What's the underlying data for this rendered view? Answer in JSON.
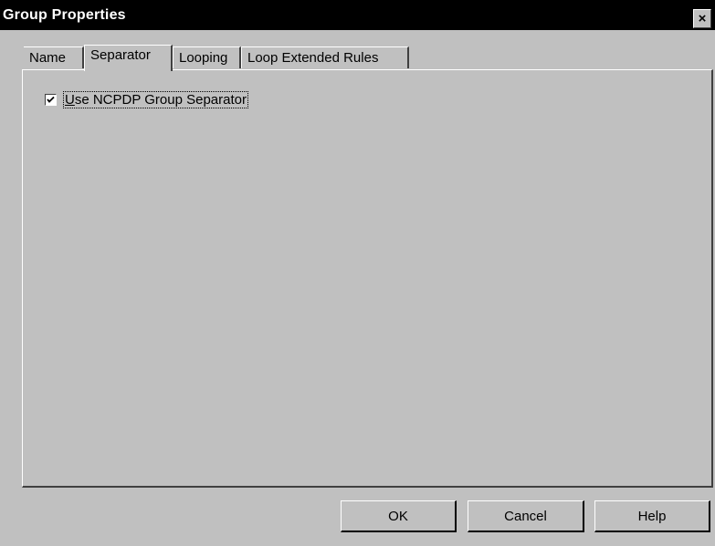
{
  "window": {
    "title": "Group Properties",
    "close_glyph": "×"
  },
  "tabs": [
    {
      "label": "Name",
      "active": false
    },
    {
      "label": "Separator",
      "active": true
    },
    {
      "label": "Looping",
      "active": false
    },
    {
      "label": "Loop Extended Rules",
      "active": false
    }
  ],
  "separator_page": {
    "checkbox": {
      "mnemonic": "U",
      "label_rest": "se NCPDP Group Separator",
      "checked": true
    }
  },
  "buttons": {
    "ok_label": "OK",
    "cancel_label": "Cancel",
    "help_label": "Help"
  },
  "icons": {
    "close": "close-icon",
    "check": "check-icon"
  }
}
